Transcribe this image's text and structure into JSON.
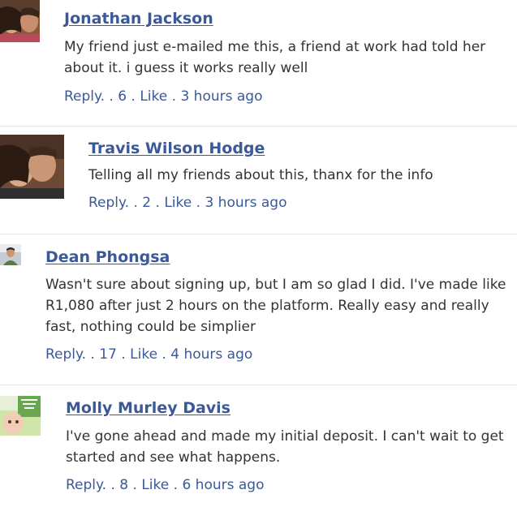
{
  "sep": " . ",
  "comments": [
    {
      "author": "Jonathan Jackson",
      "text": "My friend just e-mailed me this, a friend at work had told her about it. i guess it works really well",
      "reply": "Reply.",
      "likes": "6",
      "like": "Like",
      "time": "3 hours ago",
      "avatar_icon": "profile-photo"
    },
    {
      "author": "Travis Wilson Hodge",
      "text": "Telling all my friends about this, thanx for the info",
      "reply": "Reply.",
      "likes": "2",
      "like": "Like",
      "time": "3 hours ago",
      "avatar_icon": "profile-photo"
    },
    {
      "author": "Dean Phongsa",
      "text": "Wasn't sure about signing up, but I am so glad I did. I've made like R1,080 after just 2 hours on the platform. Really easy and really fast, nothing could be simplier",
      "reply": "Reply.",
      "likes": "17",
      "like": "Like",
      "time": "4 hours ago",
      "avatar_icon": "profile-photo"
    },
    {
      "author": "Molly Murley Davis",
      "text": "I've gone ahead and made my initial deposit. I can't wait to get started and see what happens.",
      "reply": "Reply.",
      "likes": "8",
      "like": "Like",
      "time": "6 hours ago",
      "avatar_icon": "profile-photo"
    }
  ]
}
